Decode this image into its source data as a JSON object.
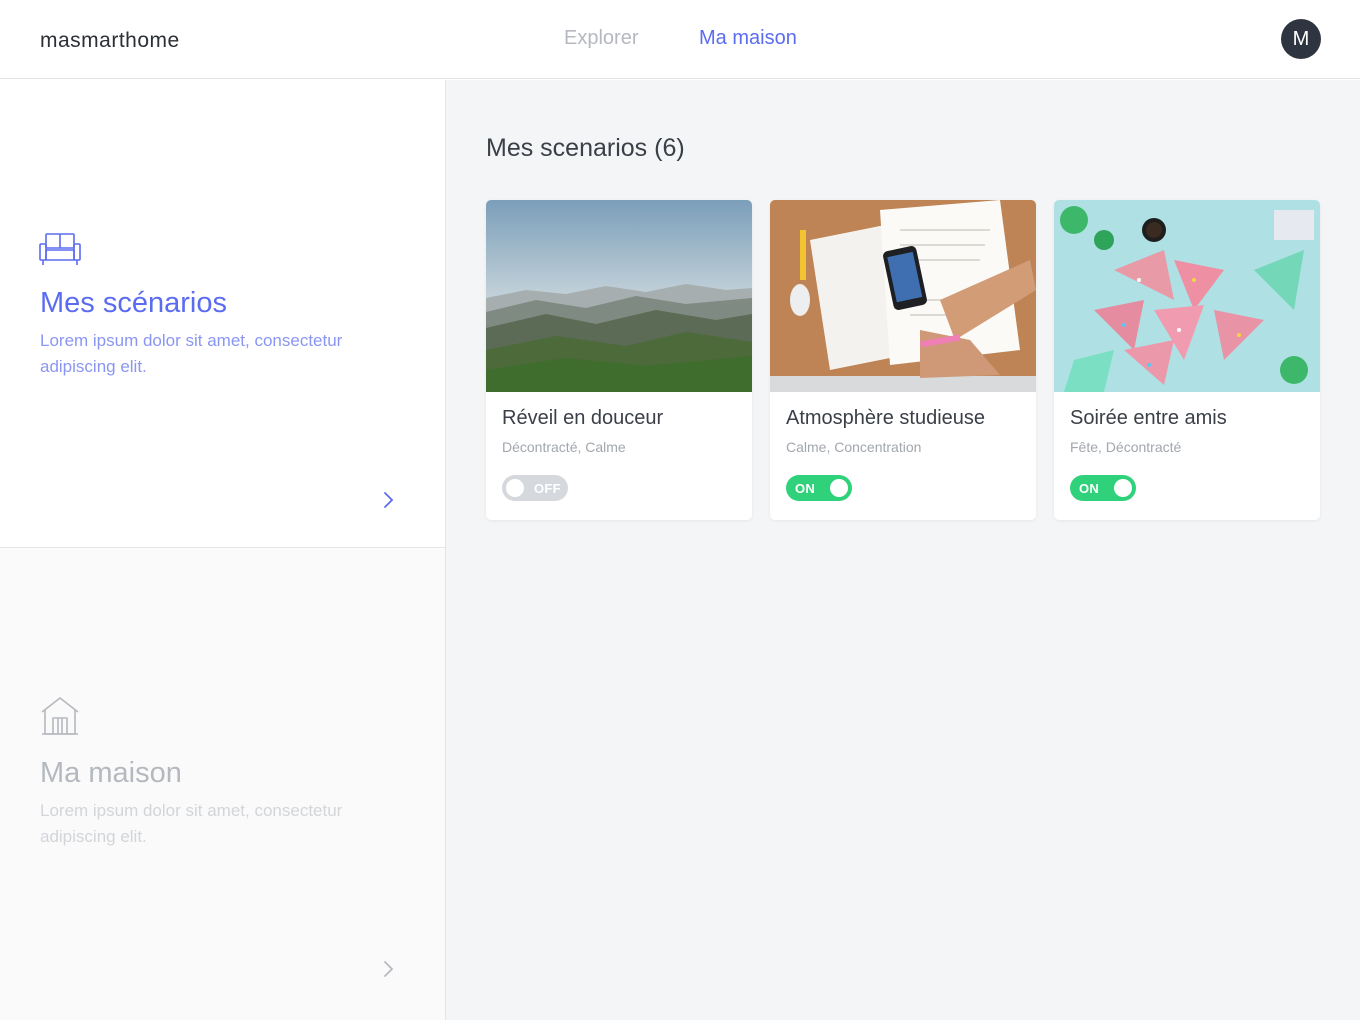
{
  "header": {
    "logo": "masmarthome",
    "nav": [
      {
        "label": "Explorer",
        "active": false
      },
      {
        "label": "Ma maison",
        "active": true
      }
    ],
    "avatar_initial": "M"
  },
  "sidebar": {
    "items": [
      {
        "title": "Mes scénarios",
        "description": "Lorem ipsum dolor sit amet, consectetur adipiscing elit.",
        "icon": "sofa-icon",
        "active": true
      },
      {
        "title": "Ma maison",
        "description": "Lorem ipsum dolor sit amet, consectetur adipiscing elit.",
        "icon": "house-icon",
        "active": false
      }
    ]
  },
  "main": {
    "section_title": "Mes scenarios (6)",
    "scenarios": [
      {
        "title": "Réveil en douceur",
        "tags": "Décontracté, Calme",
        "toggle": "OFF",
        "image": "mountain-landscape"
      },
      {
        "title": "Atmosphère studieuse",
        "tags": "Calme, Concentration",
        "toggle": "ON",
        "image": "desk-workspace"
      },
      {
        "title": "Soirée entre amis",
        "tags": "Fête, Décontracté",
        "toggle": "ON",
        "image": "party-cake"
      }
    ]
  },
  "colors": {
    "accent": "#5b6cf0",
    "toggle_on": "#2fd27a",
    "toggle_off": "#d5d8dc",
    "avatar_bg": "#2f3540"
  }
}
